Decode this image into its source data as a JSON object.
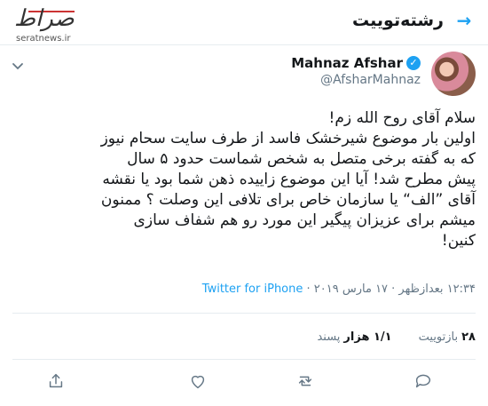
{
  "header": {
    "title": "رشته‌توییت",
    "watermark_logo": "صراط",
    "watermark_url": "seratnews.ir"
  },
  "tweet": {
    "display_name": "Mahnaz Afshar",
    "handle": "@AfsharMahnaz",
    "body_lines": [
      "سلام آقای روح الله زم!",
      "اولین بار موضوع شیرخشک فاسد از طرف سایت سحام نیوز",
      "که به گفته برخی متصل به شخص شماست حدود ۵ سال",
      "پیش مطرح شد! آیا این موضوع زاییده ذهن شما بود یا نقشه",
      "آقای ”الف“ یا سازمان خاص برای تلافی این وصلت ؟ ممنون",
      "میشم برای عزیزان پیگیر این مورد رو هم شفاف سازی",
      "کنین!"
    ],
    "timestamp": "۱۲:۳۴ بعدازظهر · ۱۷ مارس ۲۰۱۹ ·",
    "source": "Twitter for iPhone",
    "retweets_count": "۲۸",
    "retweets_label": "بازتوییت",
    "likes_count": "۱/۱ هزار",
    "likes_label": "پسند"
  },
  "icons": {
    "back": "arrow-right-icon",
    "options": "chevron-down-icon",
    "verified": "verified-badge-icon",
    "reply": "reply-icon",
    "retweet": "retweet-icon",
    "like": "heart-icon",
    "share": "share-icon"
  },
  "colors": {
    "accent": "#1da1f2",
    "text": "#14171a",
    "muted": "#657786",
    "border": "#e6ecf0"
  }
}
